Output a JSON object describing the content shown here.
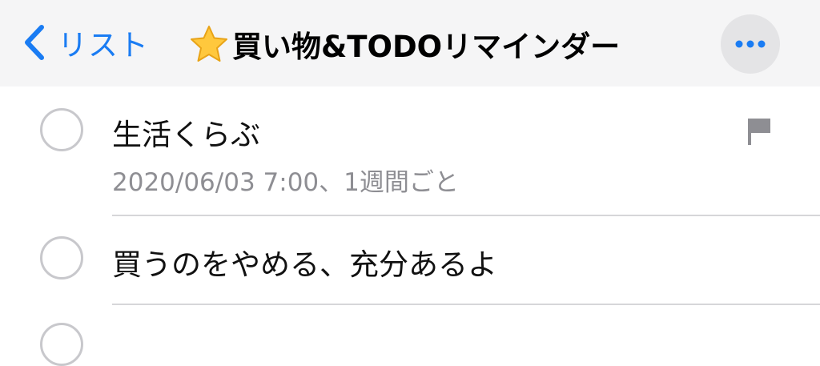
{
  "navbar": {
    "back_label": "リスト",
    "title": "買い物&TODOリマインダー",
    "title_emoji": "star-icon",
    "more_icon": "ellipsis-icon"
  },
  "reminders": [
    {
      "title": "生活くらぶ",
      "subtitle": "2020/06/03 7:00、1週間ごと",
      "flagged": true,
      "completed": false
    },
    {
      "title": "買うのをやめる、充分あるよ",
      "completed": false
    }
  ],
  "colors": {
    "accent": "#1a7cf3",
    "navbar_bg": "#f5f5f6",
    "flag": "#8e8e93",
    "circle": "#c8c8cc",
    "star": "#ffc83d"
  }
}
